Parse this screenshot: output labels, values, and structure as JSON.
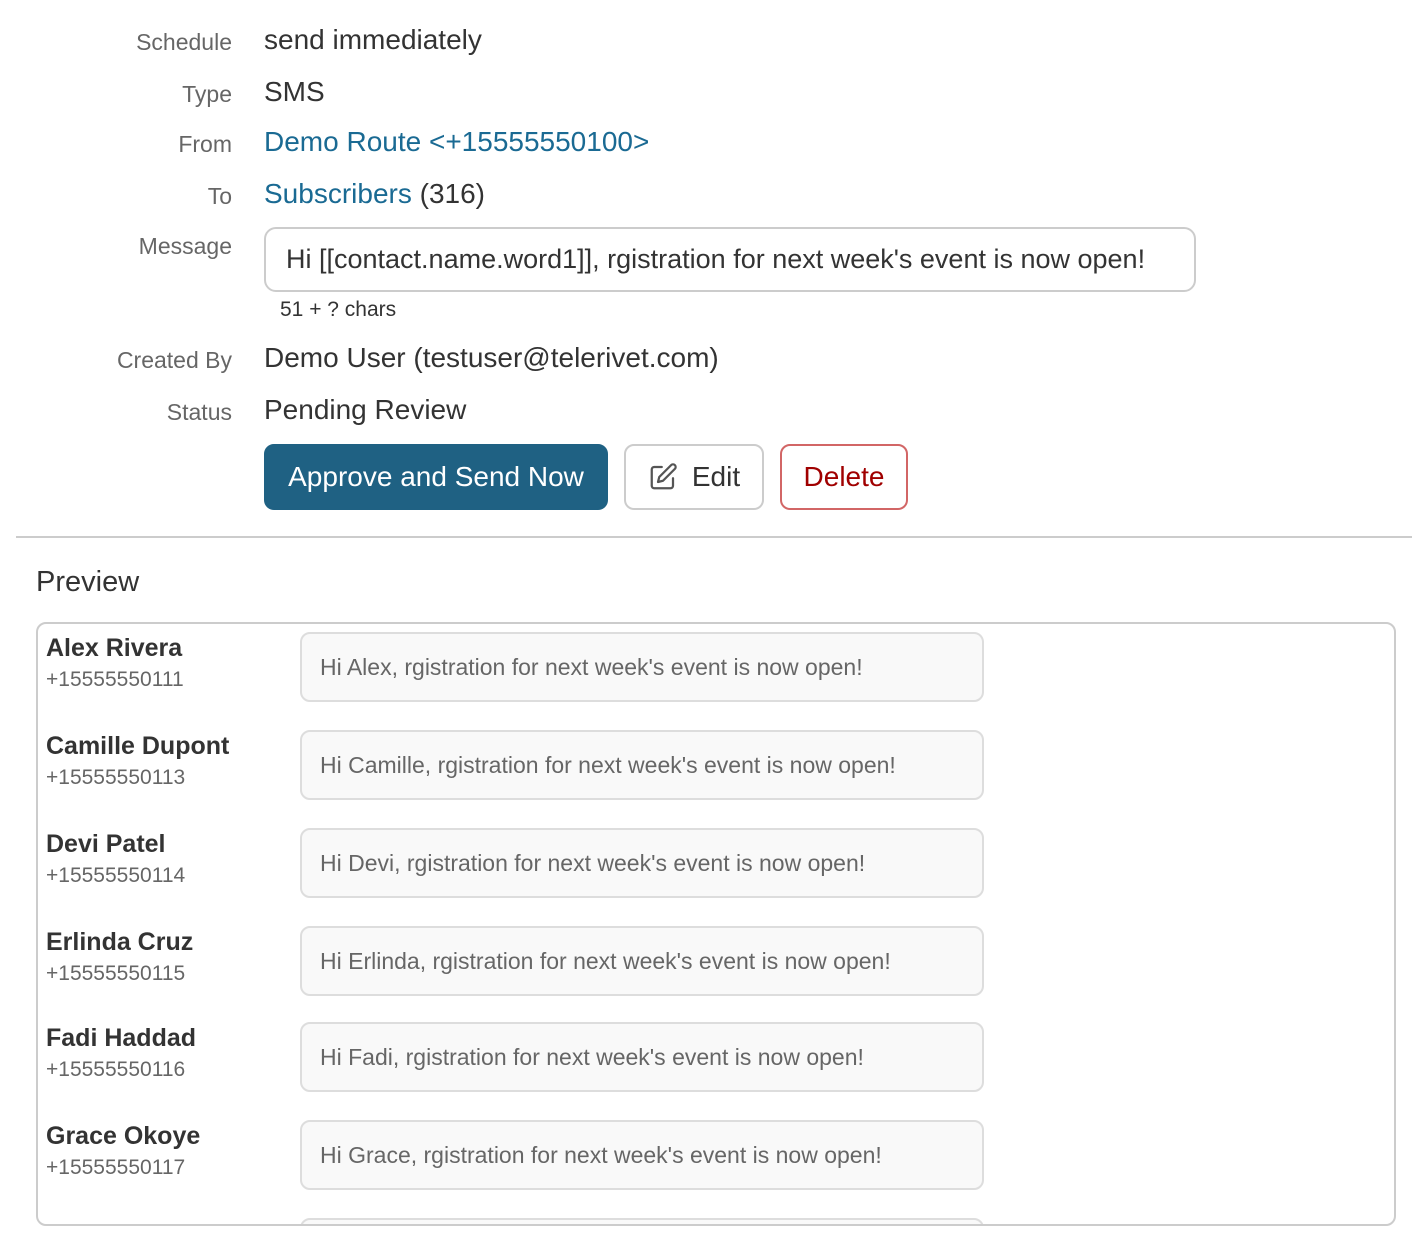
{
  "fields": {
    "schedule": {
      "label": "Schedule",
      "value": "send immediately"
    },
    "type": {
      "label": "Type",
      "value": "SMS"
    },
    "from": {
      "label": "From",
      "value": "Demo Route <+15555550100>"
    },
    "to": {
      "label": "To",
      "link": "Subscribers",
      "count": "(316)"
    },
    "message": {
      "label": "Message",
      "value": "Hi [[contact.name.word1]], rgistration for next week's event is now open!",
      "char_count": "51 + ? chars"
    },
    "created_by": {
      "label": "Created By",
      "value": "Demo User (testuser@telerivet.com)"
    },
    "status": {
      "label": "Status",
      "value": "Pending Review"
    }
  },
  "actions": {
    "approve_label": "Approve and Send Now",
    "edit_label": "Edit",
    "delete_label": "Delete"
  },
  "preview": {
    "title": "Preview",
    "items": [
      {
        "name": "Alex Rivera",
        "phone": "+15555550111",
        "message": "Hi Alex, rgistration for next week's event is now open!"
      },
      {
        "name": "Camille Dupont",
        "phone": "+15555550113",
        "message": "Hi Camille, rgistration for next week's event is now open!"
      },
      {
        "name": "Devi Patel",
        "phone": "+15555550114",
        "message": "Hi Devi, rgistration for next week's event is now open!"
      },
      {
        "name": "Erlinda Cruz",
        "phone": "+15555550115",
        "message": "Hi Erlinda, rgistration for next week's event is now open!"
      },
      {
        "name": "Fadi Haddad",
        "phone": "+15555550116",
        "message": "Hi Fadi, rgistration for next week's event is now open!"
      },
      {
        "name": "Grace Okoye",
        "phone": "+15555550117",
        "message": "Hi Grace, rgistration for next week's event is now open!"
      }
    ]
  },
  "colors": {
    "primary": "#1f6183",
    "link": "#1a6a93",
    "danger": "#a00000"
  },
  "icons": {
    "edit": "pencil-square-icon"
  }
}
